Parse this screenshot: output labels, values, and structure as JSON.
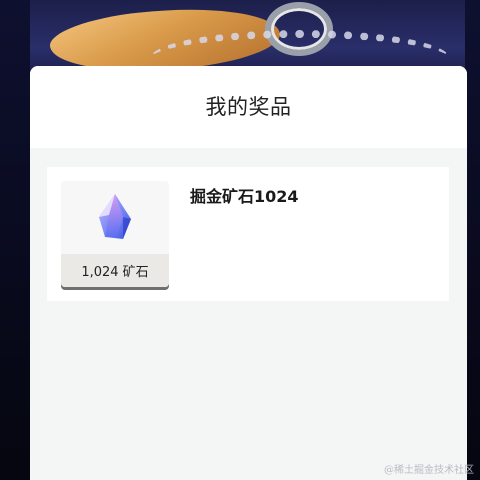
{
  "modal": {
    "title": "我的奖品"
  },
  "prize": {
    "name": "掘金矿石1024",
    "amount_label": "1,024 矿石",
    "icon": "ore-gem-icon"
  },
  "watermark": "@稀土掘金技术社区",
  "colors": {
    "sheet_bg": "#f4f5f5",
    "card_bg": "#ffffff",
    "gem_blue": "#4a6cf0",
    "gem_purple": "#b06ae6"
  }
}
